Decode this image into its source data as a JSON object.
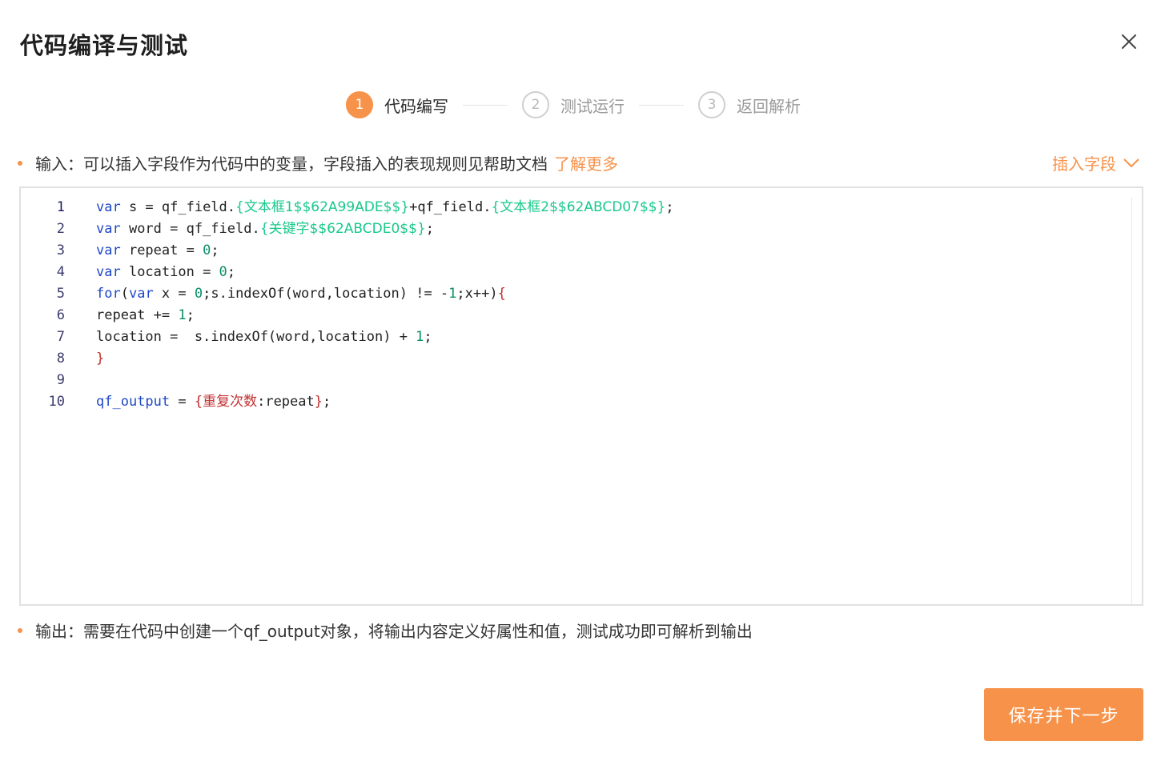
{
  "dialog": {
    "title": "代码编译与测试"
  },
  "steps": [
    {
      "number": "1",
      "label": "代码编写",
      "active": true
    },
    {
      "number": "2",
      "label": "测试运行",
      "active": false
    },
    {
      "number": "3",
      "label": "返回解析",
      "active": false
    }
  ],
  "input_hint": {
    "text": "输入：可以插入字段作为代码中的变量，字段插入的表现规则见帮助文档",
    "link": "了解更多"
  },
  "insert_field": {
    "label": "插入字段"
  },
  "code_lines": [
    {
      "num": "1",
      "parts": [
        {
          "t": "var",
          "c": "kw"
        },
        {
          "t": " s = qf_field.",
          "c": ""
        },
        {
          "t": "{文本框1$$62A99ADE$$}",
          "c": "fld"
        },
        {
          "t": "+qf_field.",
          "c": ""
        },
        {
          "t": "{文本框2$$62ABCD07$$}",
          "c": "fld"
        },
        {
          "t": ";",
          "c": ""
        }
      ]
    },
    {
      "num": "2",
      "parts": [
        {
          "t": "var",
          "c": "kw"
        },
        {
          "t": " word = qf_field.",
          "c": ""
        },
        {
          "t": "{关键字$$62ABCDE0$$}",
          "c": "fld"
        },
        {
          "t": ";",
          "c": ""
        }
      ]
    },
    {
      "num": "3",
      "parts": [
        {
          "t": "var",
          "c": "kw"
        },
        {
          "t": " repeat = ",
          "c": ""
        },
        {
          "t": "0",
          "c": "num"
        },
        {
          "t": ";",
          "c": ""
        }
      ]
    },
    {
      "num": "4",
      "parts": [
        {
          "t": "var",
          "c": "kw"
        },
        {
          "t": " location = ",
          "c": ""
        },
        {
          "t": "0",
          "c": "num"
        },
        {
          "t": ";",
          "c": ""
        }
      ]
    },
    {
      "num": "5",
      "parts": [
        {
          "t": "for",
          "c": "kw"
        },
        {
          "t": "(",
          "c": ""
        },
        {
          "t": "var",
          "c": "kw"
        },
        {
          "t": " x = ",
          "c": ""
        },
        {
          "t": "0",
          "c": "num"
        },
        {
          "t": ";s.indexOf(word,location) != -",
          "c": ""
        },
        {
          "t": "1",
          "c": "num"
        },
        {
          "t": ";x++)",
          "c": ""
        },
        {
          "t": "{",
          "c": "brk"
        }
      ]
    },
    {
      "num": "6",
      "parts": [
        {
          "t": "repeat += ",
          "c": ""
        },
        {
          "t": "1",
          "c": "num"
        },
        {
          "t": ";",
          "c": ""
        }
      ]
    },
    {
      "num": "7",
      "parts": [
        {
          "t": "location =  s.indexOf(word,location) + ",
          "c": ""
        },
        {
          "t": "1",
          "c": "num"
        },
        {
          "t": ";",
          "c": ""
        }
      ]
    },
    {
      "num": "8",
      "parts": [
        {
          "t": "}",
          "c": "brk"
        }
      ]
    },
    {
      "num": "9",
      "parts": []
    },
    {
      "num": "10",
      "parts": [
        {
          "t": "qf_output",
          "c": "kw"
        },
        {
          "t": " = ",
          "c": ""
        },
        {
          "t": "{",
          "c": "brk"
        },
        {
          "t": "重复次数",
          "c": "red"
        },
        {
          "t": ":repeat",
          "c": ""
        },
        {
          "t": "}",
          "c": "brk"
        },
        {
          "t": ";",
          "c": ""
        }
      ]
    }
  ],
  "output_hint": {
    "text": "输出：需要在代码中创建一个qf_output对象，将输出内容定义好属性和值，测试成功即可解析到输出"
  },
  "buttons": {
    "save_next": "保存并下一步"
  },
  "colors": {
    "accent": "#f7924a",
    "keyword": "#1e47c7",
    "field": "#18c98b",
    "number": "#0b8f69",
    "brace": "#c23030"
  },
  "icons": {
    "close": "close-icon",
    "chevron": "chevron-down-icon"
  }
}
